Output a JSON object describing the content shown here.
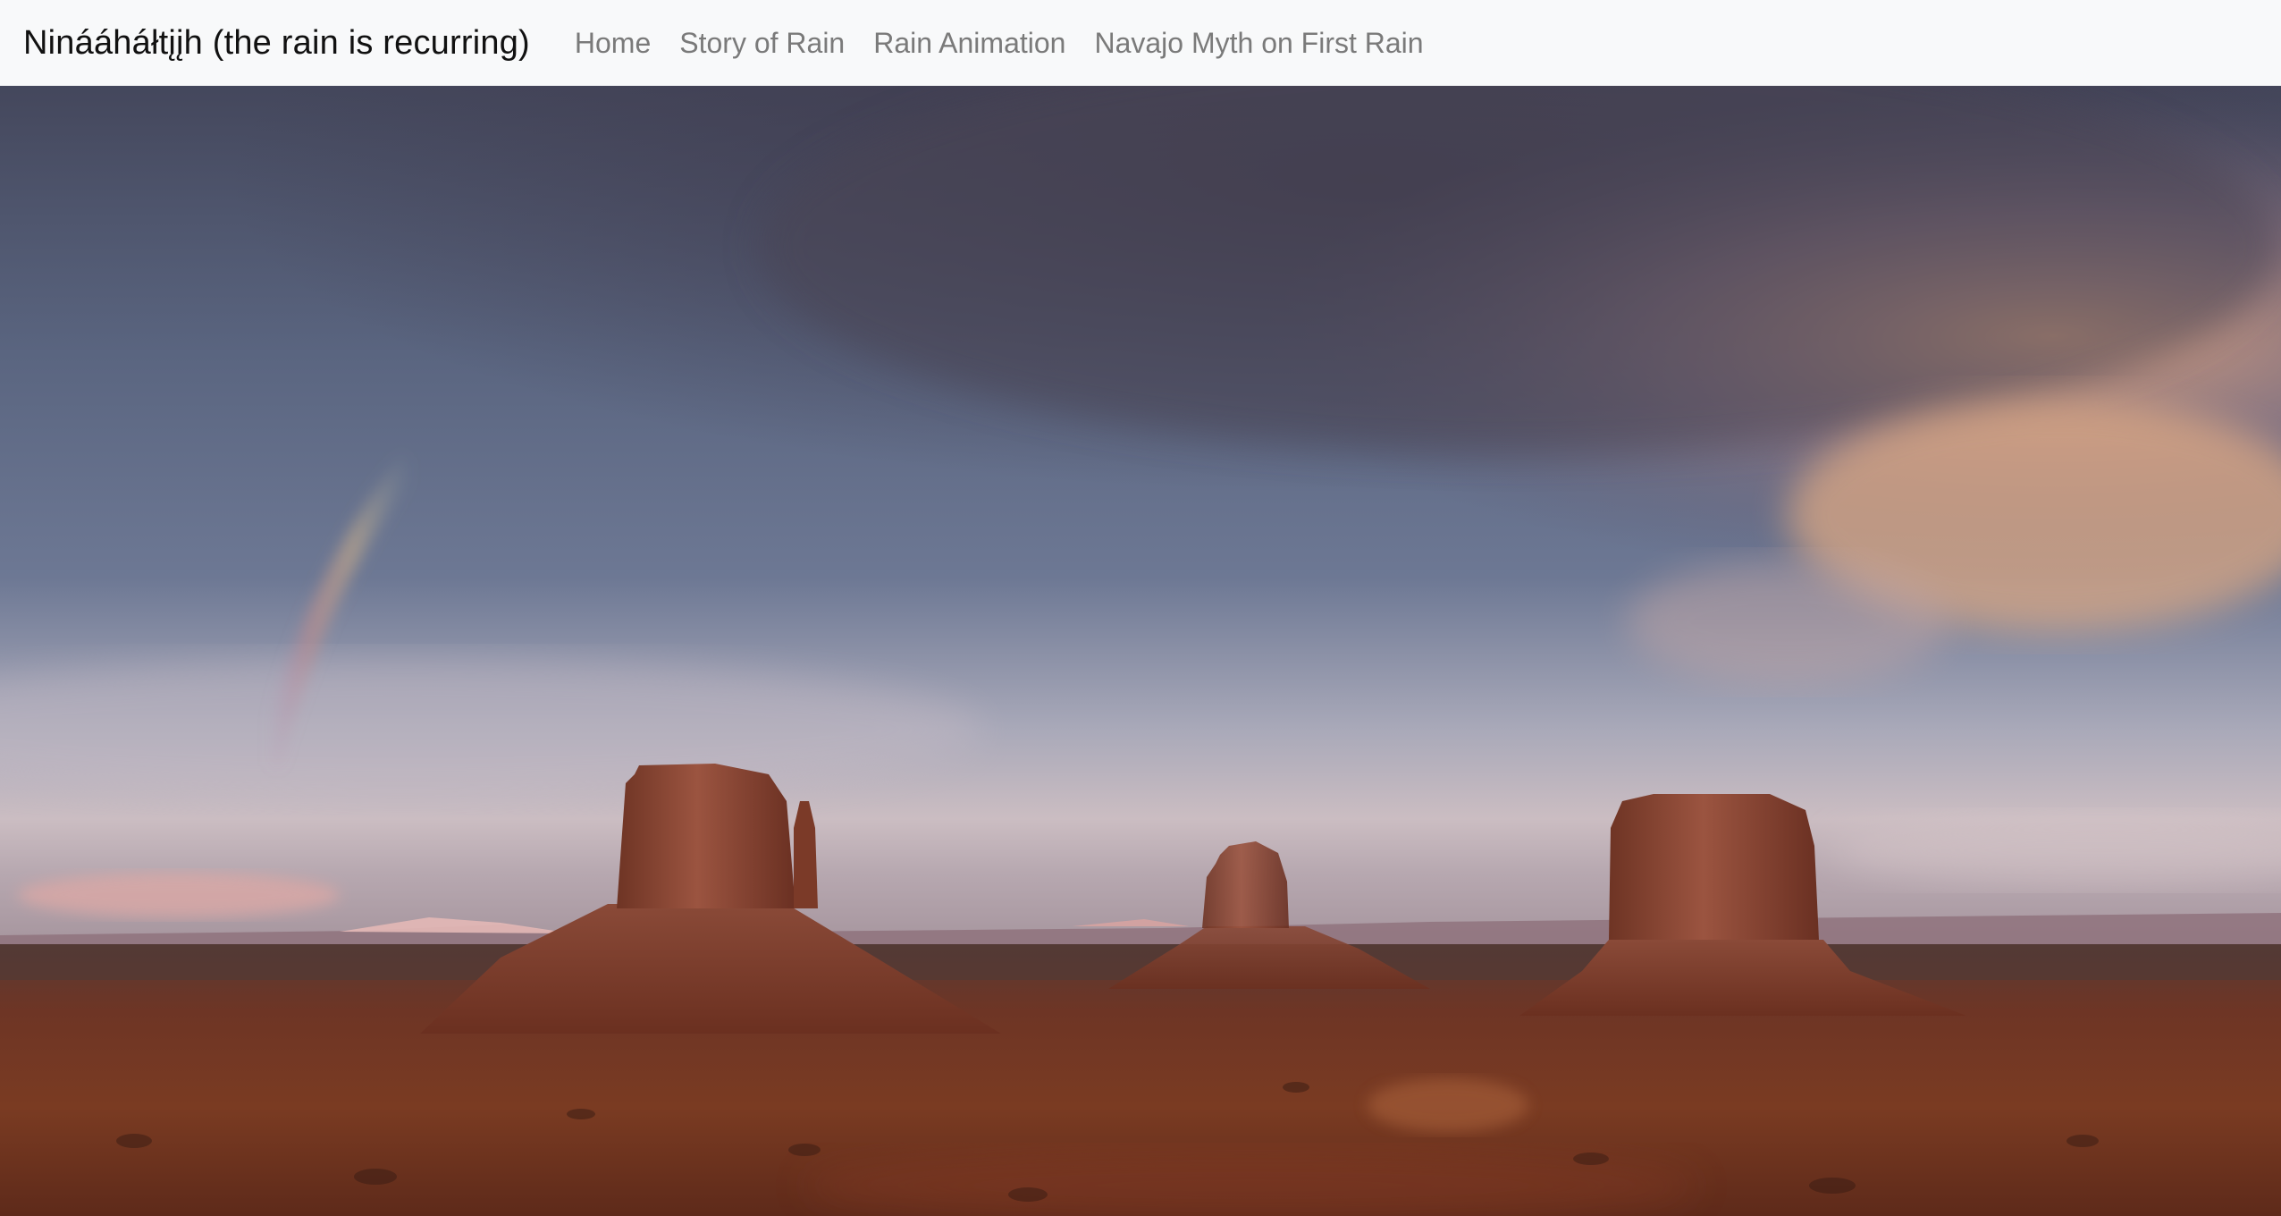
{
  "navbar": {
    "brand": "Ninááháłtįįh (the rain is recurring)",
    "links": [
      {
        "label": "Home"
      },
      {
        "label": "Story of Rain"
      },
      {
        "label": "Rain Animation"
      },
      {
        "label": "Navajo Myth on First Rain"
      }
    ]
  },
  "hero": {
    "icon": "monument-valley-storm-photo",
    "colors": {
      "sky_top": "#4a4f66",
      "sky_mid": "#6a7590",
      "horizon": "#c9b8bd",
      "ground": "#6b2f1f",
      "rock": "#8a4530",
      "rock_shadow": "#5e2b1e"
    }
  }
}
